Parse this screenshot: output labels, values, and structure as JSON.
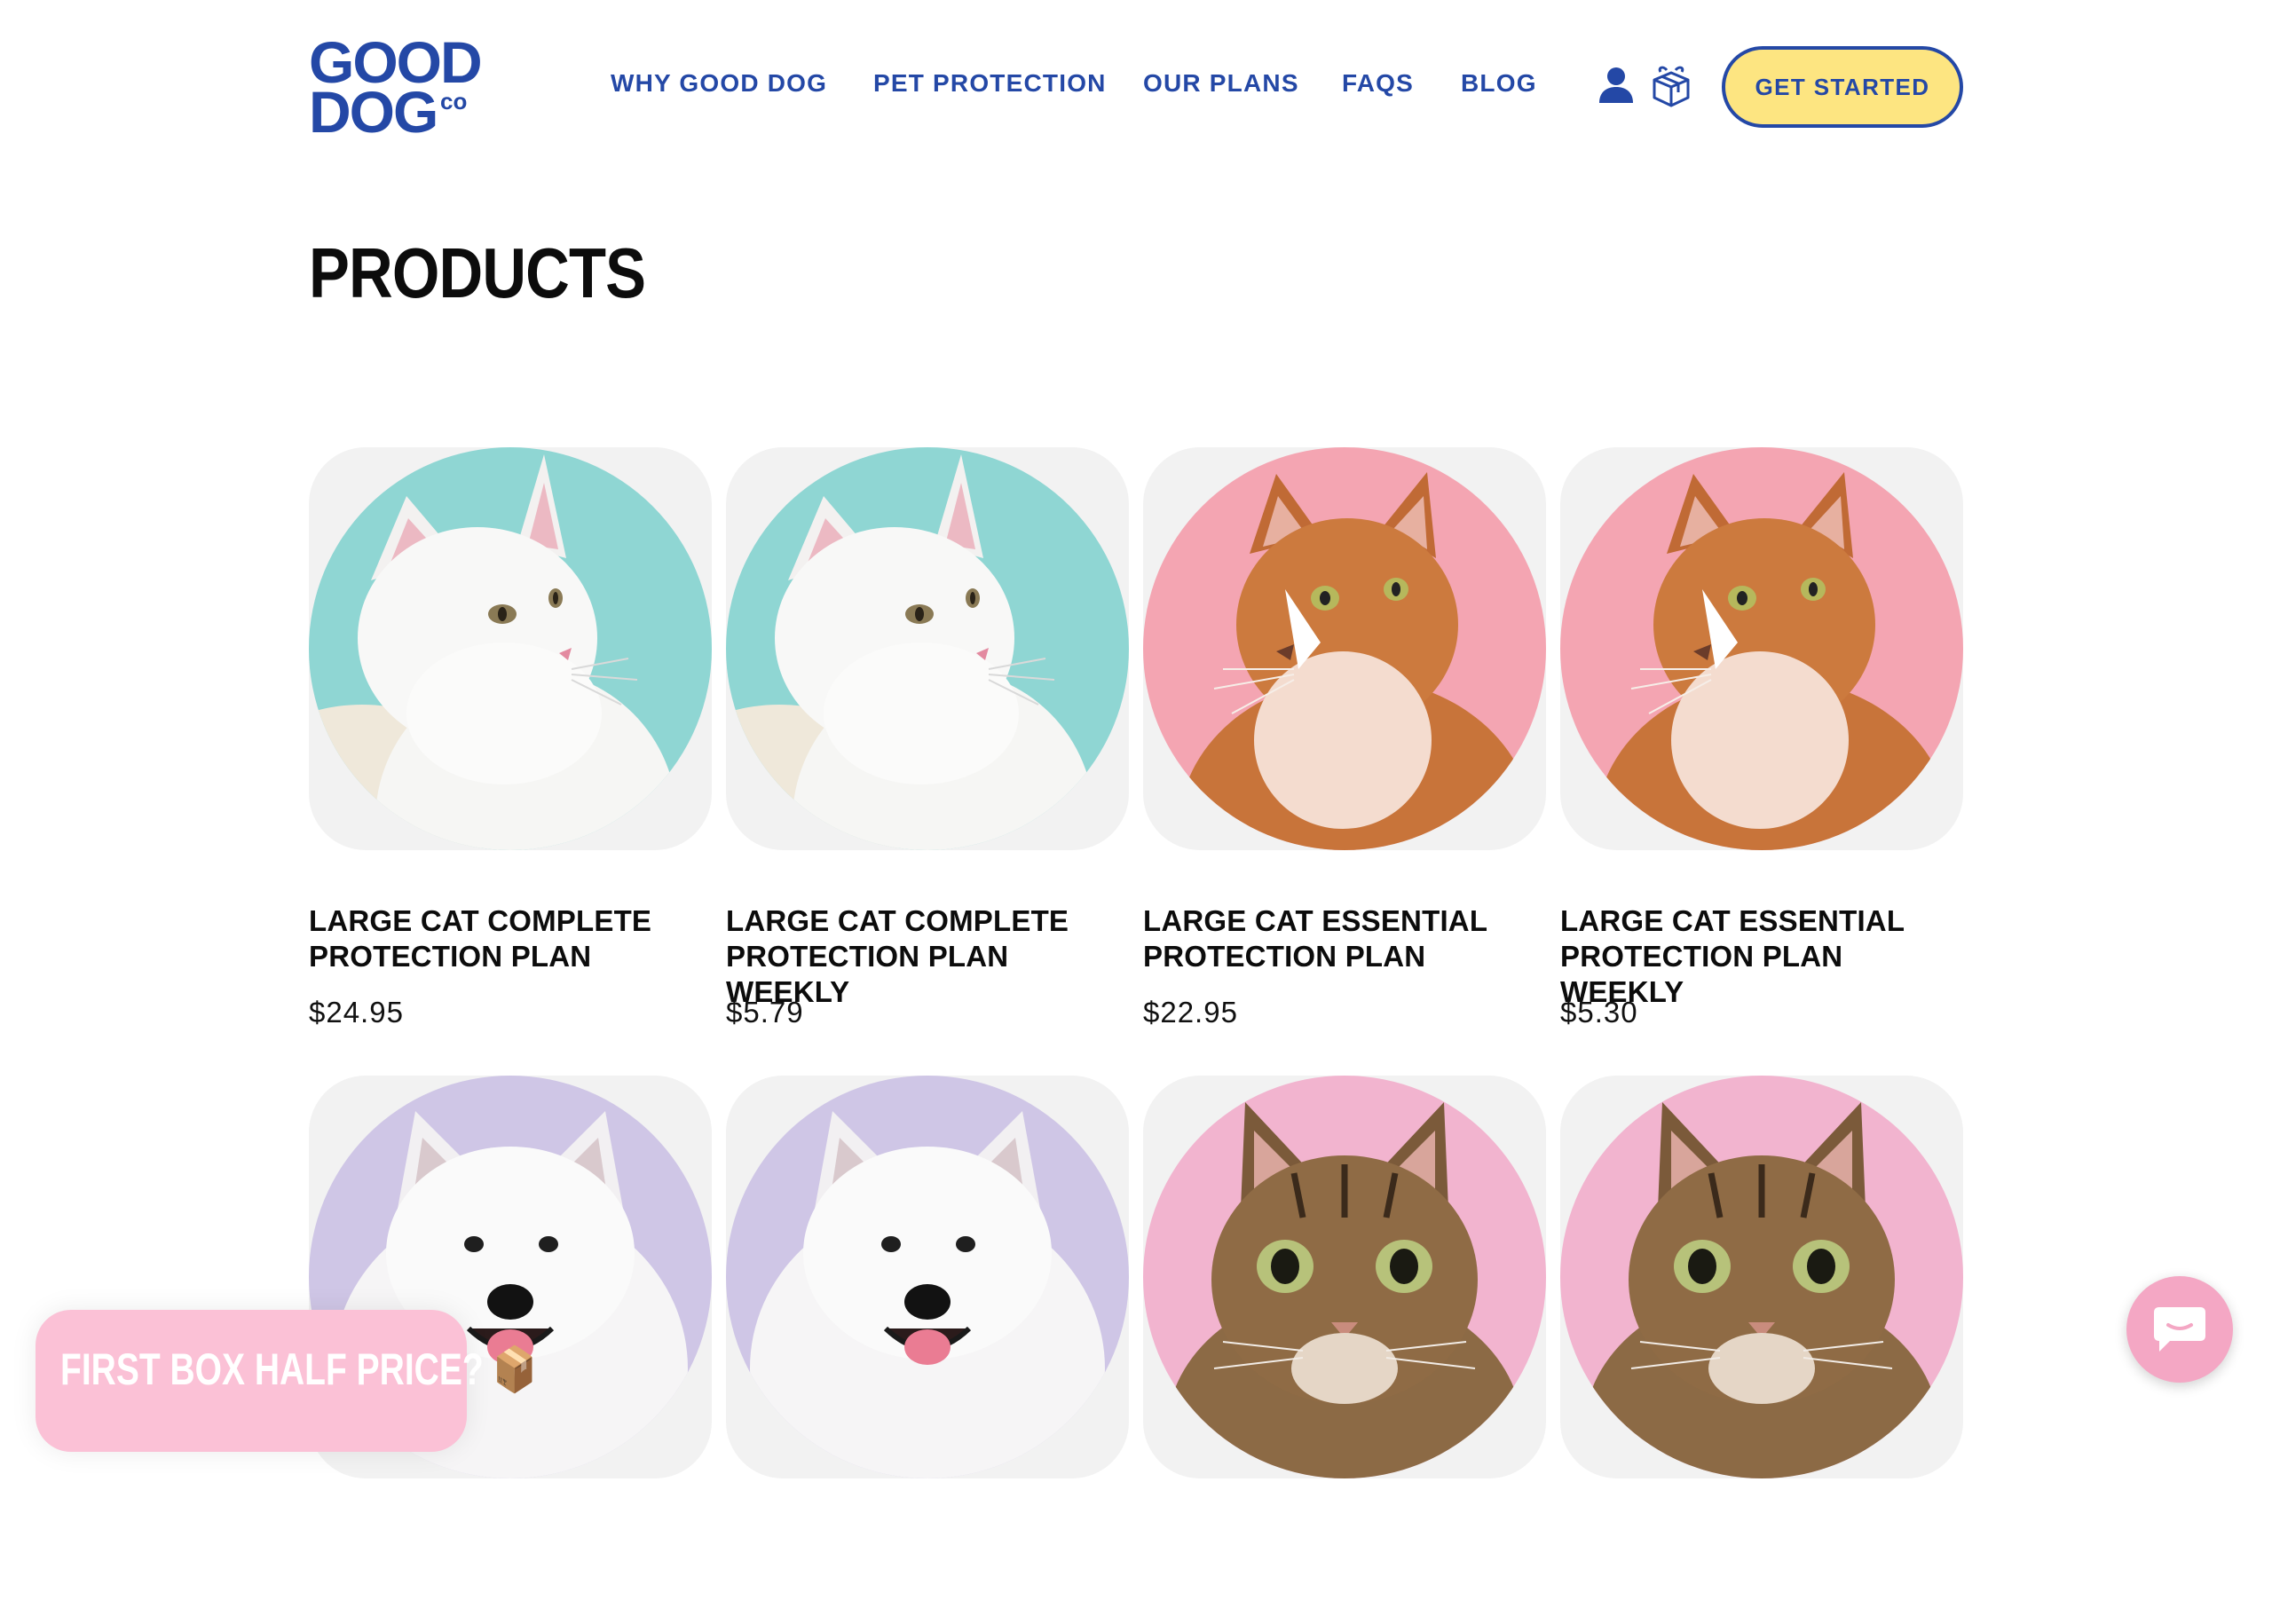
{
  "header": {
    "logo": {
      "line1": "GOOD",
      "line2": "DOG",
      "co": "co"
    },
    "nav": [
      {
        "label": "WHY GOOD DOG"
      },
      {
        "label": "PET PROTECTION"
      },
      {
        "label": "OUR PLANS"
      },
      {
        "label": "FAQS"
      },
      {
        "label": "BLOG"
      }
    ],
    "icons": [
      "account-icon",
      "gift-box-icon"
    ],
    "cta_label": "GET STARTED"
  },
  "page": {
    "title": "PRODUCTS"
  },
  "products": [
    {
      "name": "LARGE CAT COMPLETE PROTECTION PLAN",
      "price": "$24.95",
      "pet": "white-cat",
      "bg": "#8fd6d3"
    },
    {
      "name": "LARGE CAT COMPLETE PROTECTION PLAN WEEKLY",
      "price": "$5.79",
      "pet": "white-cat",
      "bg": "#8fd6d3"
    },
    {
      "name": "LARGE CAT ESSENTIAL PROTECTION PLAN",
      "price": "$22.95",
      "pet": "ginger-cat",
      "bg": "#f4a5b2"
    },
    {
      "name": "LARGE CAT ESSENTIAL PROTECTION PLAN WEEKLY",
      "price": "$5.30",
      "pet": "ginger-cat",
      "bg": "#f4a5b2"
    },
    {
      "name": "",
      "price": "",
      "pet": "samoyed-dog",
      "bg": "#cfc6e6"
    },
    {
      "name": "",
      "price": "",
      "pet": "samoyed-dog",
      "bg": "#cfc6e6"
    },
    {
      "name": "",
      "price": "",
      "pet": "tabby-cat",
      "bg": "#f2b4cf"
    },
    {
      "name": "",
      "price": "",
      "pet": "tabby-cat",
      "bg": "#f2b4cf"
    }
  ],
  "promo": {
    "text": "FIRST BOX HALF PRICE? 📦"
  },
  "chat": {
    "icon": "chat-icon"
  },
  "colors": {
    "brand": "#2448a6",
    "cta": "#fde581",
    "promo": "#fbc1d6",
    "chat": "#f4a7c4"
  }
}
